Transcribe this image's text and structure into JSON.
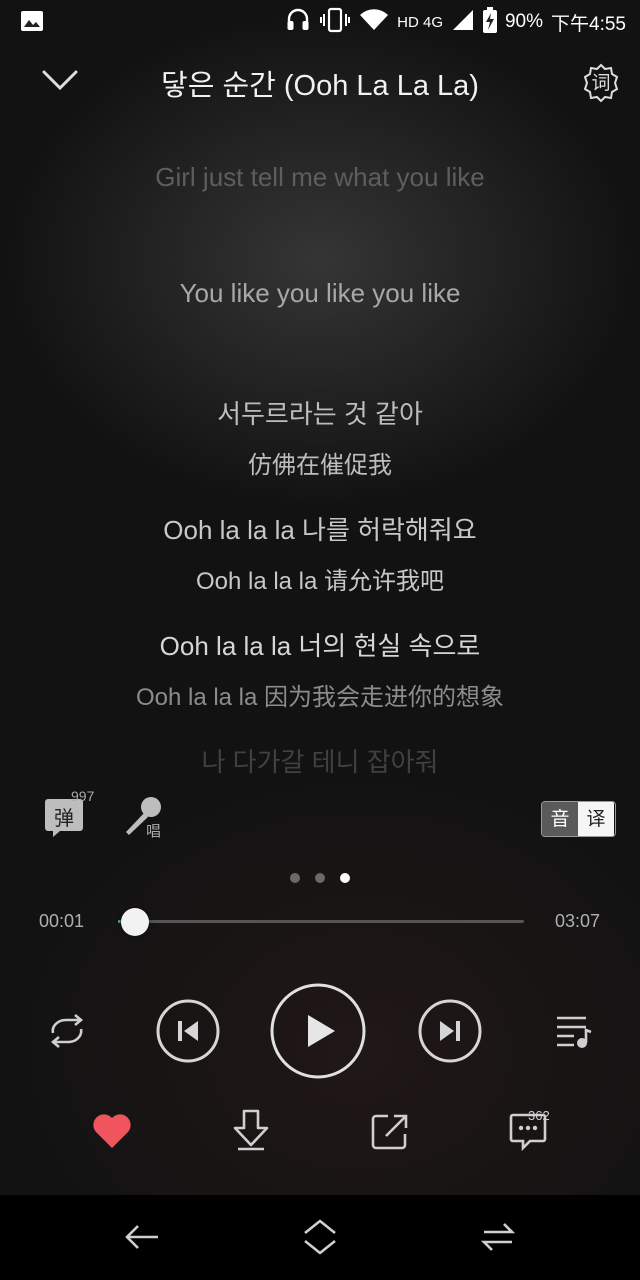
{
  "status_bar": {
    "network": "HD 4G",
    "battery": "90%",
    "time": "下午4:55",
    "icons": [
      "gallery-icon",
      "headphones-icon",
      "vibrate-icon",
      "wifi-icon",
      "signal-icon",
      "battery-charging-icon"
    ]
  },
  "header": {
    "title": "닿은 순간 (Ooh La La La)",
    "lyric_toggle_label": "词"
  },
  "lyrics": [
    {
      "text": "Girl just tell me what you like",
      "style": "past"
    },
    {
      "text": "You like you like you like",
      "style": "past"
    },
    {
      "text": "서두르라는 것 같아",
      "style": "original"
    },
    {
      "text": "仿佛在催促我",
      "style": "translation"
    },
    {
      "text": "Ooh la la la 나를 허락해줘요",
      "style": "original"
    },
    {
      "text": "Ooh la la la 请允许我吧",
      "style": "translation"
    },
    {
      "text": "Ooh la la la 너의 현실 속으로",
      "style": "current"
    },
    {
      "text": "Ooh la la la 因为我会走进你的想象",
      "style": "current-translation"
    },
    {
      "text": "나 다가갈 테니 잡아줘",
      "style": "upcoming"
    }
  ],
  "tools": {
    "danmu_label": "弹",
    "danmu_count": "997",
    "sing_label": "唱",
    "lang_original": "音",
    "lang_translation": "译"
  },
  "pager": {
    "count": 3,
    "active": 2
  },
  "progress": {
    "current": "00:01",
    "total": "03:07",
    "fraction": 0.005
  },
  "player": {
    "state": "paused",
    "icons": [
      "repeat-icon",
      "previous-icon",
      "play-icon",
      "next-icon",
      "playlist-icon"
    ]
  },
  "actions": {
    "liked": true,
    "like_color": "#f0555d",
    "comment_count": "362",
    "icons": [
      "heart-icon",
      "download-icon",
      "share-icon",
      "comment-icon"
    ]
  },
  "colors": {
    "accent": "#31c27c",
    "heart": "#f0555d"
  }
}
